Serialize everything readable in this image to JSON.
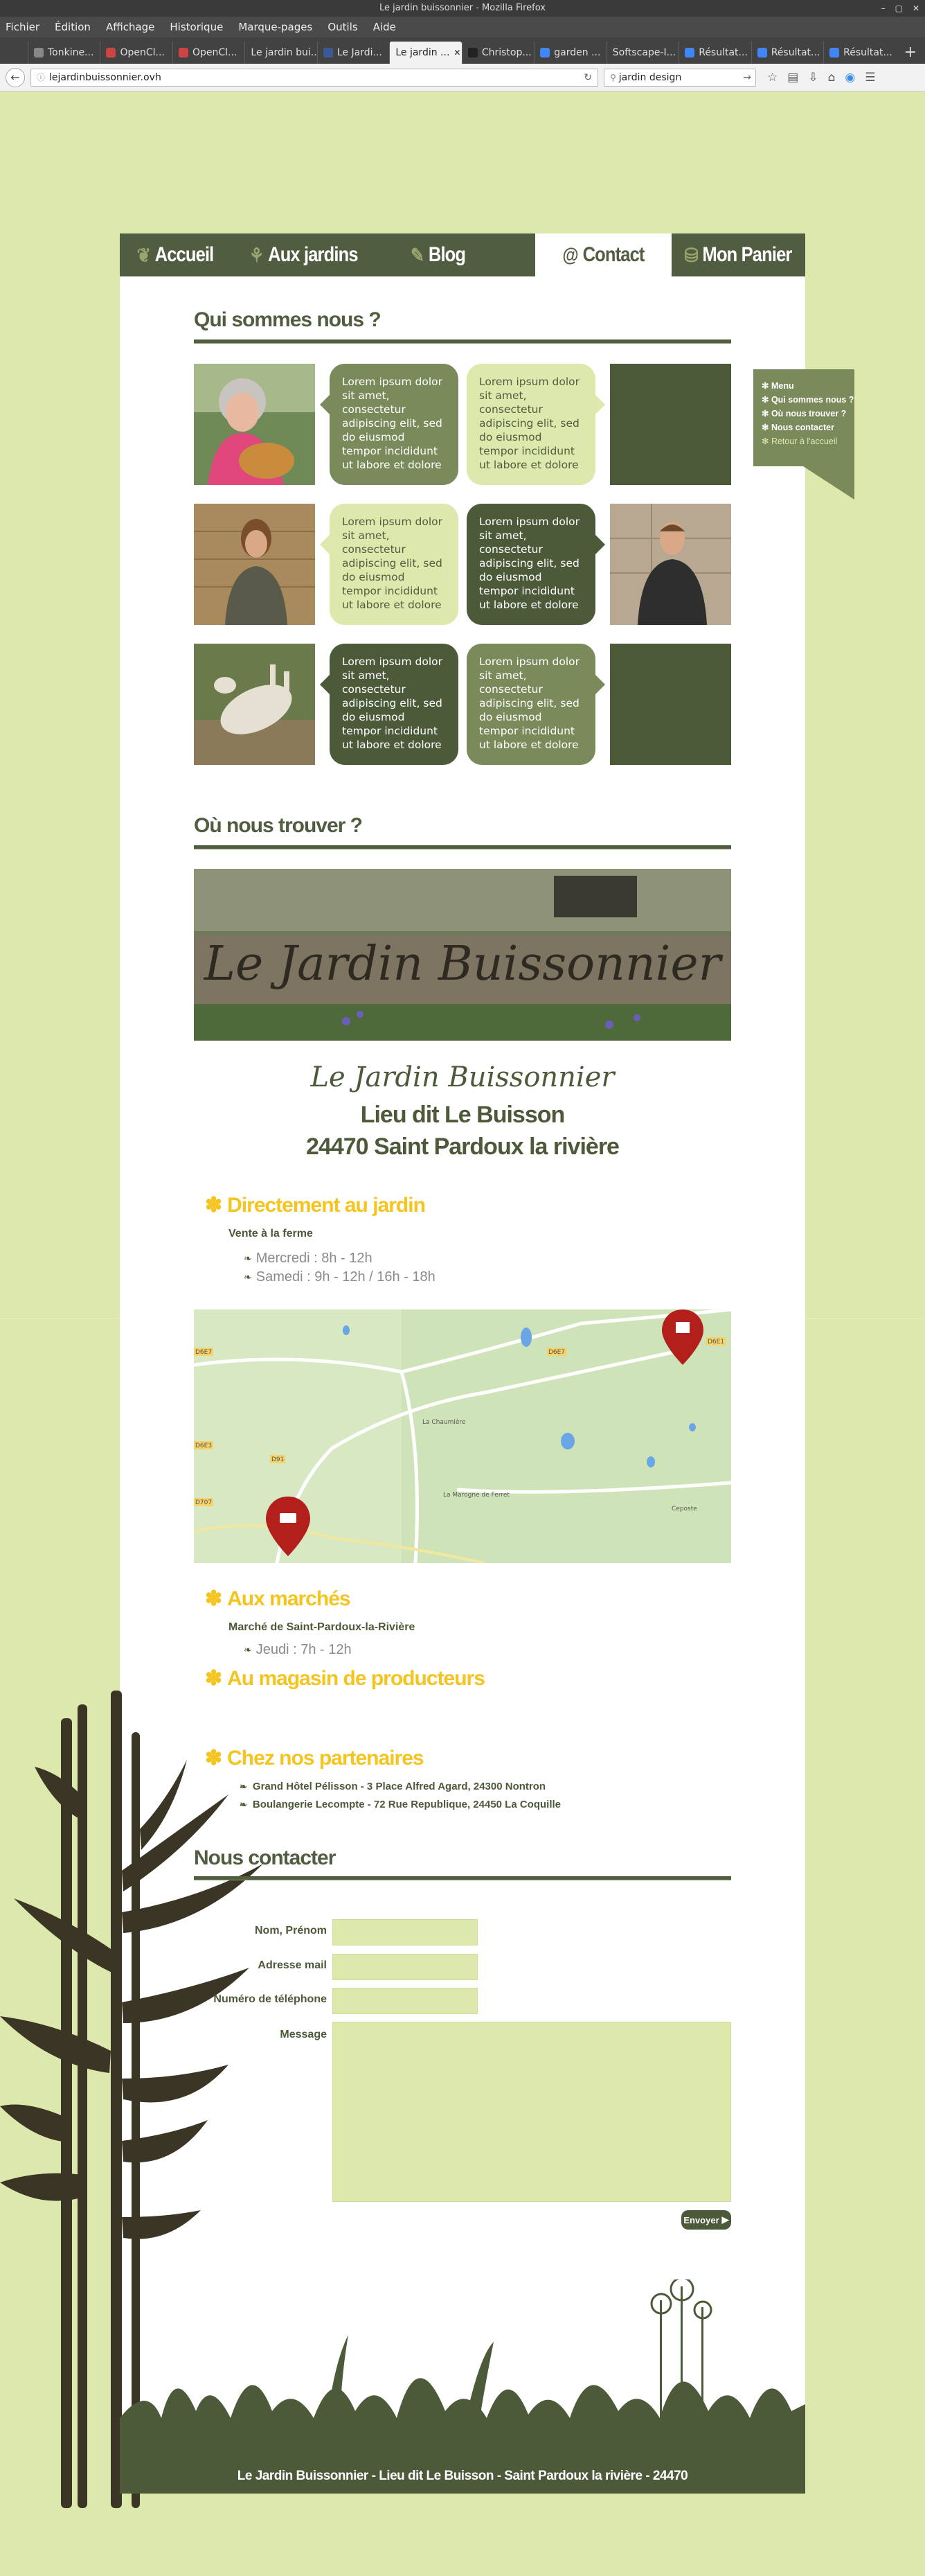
{
  "browser": {
    "window_title": "Le jardin buissonnier - Mozilla Firefox",
    "menu": [
      "Fichier",
      "Édition",
      "Affichage",
      "Historique",
      "Marque-pages",
      "Outils",
      "Aide"
    ],
    "tabs": [
      {
        "label": "Tonkine...",
        "active": false
      },
      {
        "label": "OpenCl...",
        "active": false
      },
      {
        "label": "OpenCl...",
        "active": false
      },
      {
        "label": "Le jardin bui...",
        "active": false
      },
      {
        "label": "Le Jardi...",
        "active": false
      },
      {
        "label": "Le jardin ...",
        "active": true
      },
      {
        "label": "Christop...",
        "active": false
      },
      {
        "label": "garden ...",
        "active": false
      },
      {
        "label": "Softscape-I...",
        "active": false
      },
      {
        "label": "Résultat...",
        "active": false
      },
      {
        "label": "Résultat...",
        "active": false
      },
      {
        "label": "Résultat...",
        "active": false
      }
    ],
    "url": "lejardinbuissonnier.ovh",
    "search_value": "jardin design"
  },
  "nav": [
    {
      "label": "Accueil",
      "icon": "leaf-icon"
    },
    {
      "label": "Aux jardins",
      "icon": "sprout-icon"
    },
    {
      "label": "Blog",
      "icon": "pen-icon"
    },
    {
      "label": "Contact",
      "icon": "at-icon",
      "active": true
    },
    {
      "label": "Mon Panier",
      "icon": "basket-icon"
    }
  ],
  "about": {
    "title": "Qui sommes nous ?",
    "bubble_text": "Lorem ipsum dolor sit amet, consectetur adipiscing elit, sed do eiusmod tempor incididunt ut labore et dolore"
  },
  "sidemenu": {
    "items": [
      {
        "label": "Menu",
        "active": true
      },
      {
        "label": "Qui sommes nous ?",
        "active": true
      },
      {
        "label": "Où nous trouver ?",
        "active": true
      },
      {
        "label": "Nous contacter",
        "active": true
      },
      {
        "label": "Retour à l'accueil",
        "active": false
      }
    ]
  },
  "find": {
    "title": "Où nous trouver ?",
    "sign_text": "Le Jardin Buissonnier",
    "brand": "Le Jardin Buissonnier",
    "address_line1": "Lieu dit Le Buisson",
    "address_line2": "24470 Saint Pardoux la rivière",
    "direct_title": "Directement au jardin",
    "direct_sub": "Vente à la ferme",
    "direct_schedule": [
      "Mercredi : 8h - 12h",
      "Samedi : 9h - 12h / 16h - 18h"
    ],
    "markets_title": "Aux marchés",
    "markets_sub": "Marché de Saint-Pardoux-la-Rivière",
    "markets_schedule": [
      "Jeudi : 7h - 12h"
    ],
    "store_title": "Au magasin de producteurs",
    "partners_title": "Chez nos partenaires",
    "partners": [
      "Grand Hôtel Pélisson - 3 Place Alfred Agard, 24300 Nontron",
      "Boulangerie Lecompte - 72 Rue Republique, 24450 La Coquille"
    ],
    "map_labels": [
      "D6E7",
      "D6E7",
      "D6E1",
      "D6E3",
      "D91",
      "D707",
      "La Chaumière",
      "La Marogne de Ferret",
      "Ceposte"
    ]
  },
  "contact": {
    "title": "Nous contacter",
    "name_label": "Nom, Prénom",
    "email_label": "Adresse mail",
    "phone_label": "Numéro de téléphone",
    "message_label": "Message",
    "submit_label": "Envoyer"
  },
  "footer": {
    "text": "Le Jardin Buissonnier - Lieu dit Le Buisson - Saint Pardoux la rivière - 24470"
  },
  "colors": {
    "page_bg": "#dde8ad",
    "dark_green": "#4c5a3a",
    "mid_green": "#7a8a5a",
    "accent_yellow": "#f5c41e"
  }
}
